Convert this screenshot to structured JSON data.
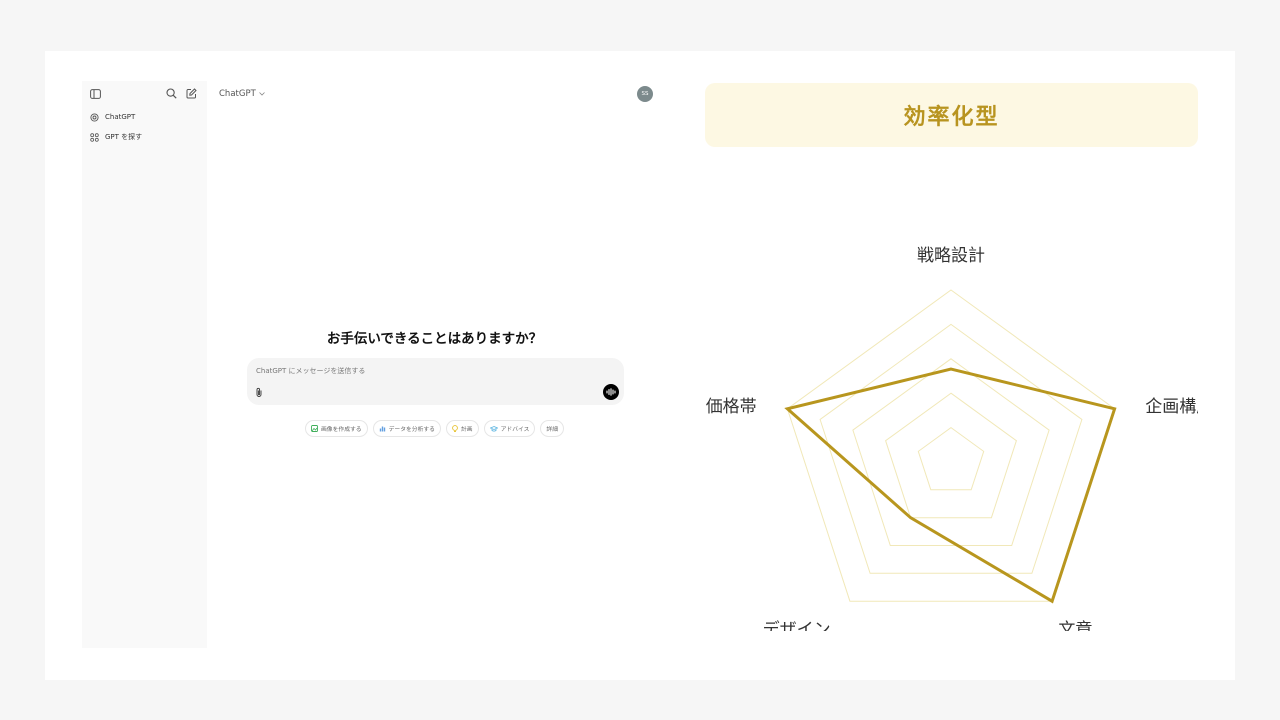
{
  "sidebar": {
    "items": [
      {
        "label": "ChatGPT",
        "icon": "chatgpt-logo-icon"
      },
      {
        "label": "GPT を探す",
        "icon": "grid-icon"
      }
    ]
  },
  "header": {
    "model": "ChatGPT",
    "avatar_initials": "SS"
  },
  "main": {
    "greeting": "お手伝いできることはありますか？",
    "composer_placeholder": "ChatGPT にメッセージを送信する",
    "chips": [
      {
        "label": "画像を作成する",
        "icon": "image-icon",
        "color": "#3fae5a"
      },
      {
        "label": "データを分析する",
        "icon": "chart-icon",
        "color": "#64a0e0"
      },
      {
        "label": "計画",
        "icon": "lightbulb-icon",
        "color": "#e6c02a"
      },
      {
        "label": "アドバイス",
        "icon": "graduation-cap-icon",
        "color": "#5ab4e0"
      },
      {
        "label": "詳細",
        "icon": "",
        "color": ""
      }
    ]
  },
  "panel": {
    "title": "効率化型",
    "accent_color": "#b8961e",
    "title_bg": "#fdf8e3"
  },
  "chart_data": {
    "type": "radar",
    "axes": [
      "戦略設計",
      "企画構成",
      "文章",
      "デザイン",
      "価格帯"
    ],
    "values": [
      2.7,
      5,
      5,
      2,
      5
    ],
    "max": 5,
    "rings": 5,
    "grid": true
  }
}
